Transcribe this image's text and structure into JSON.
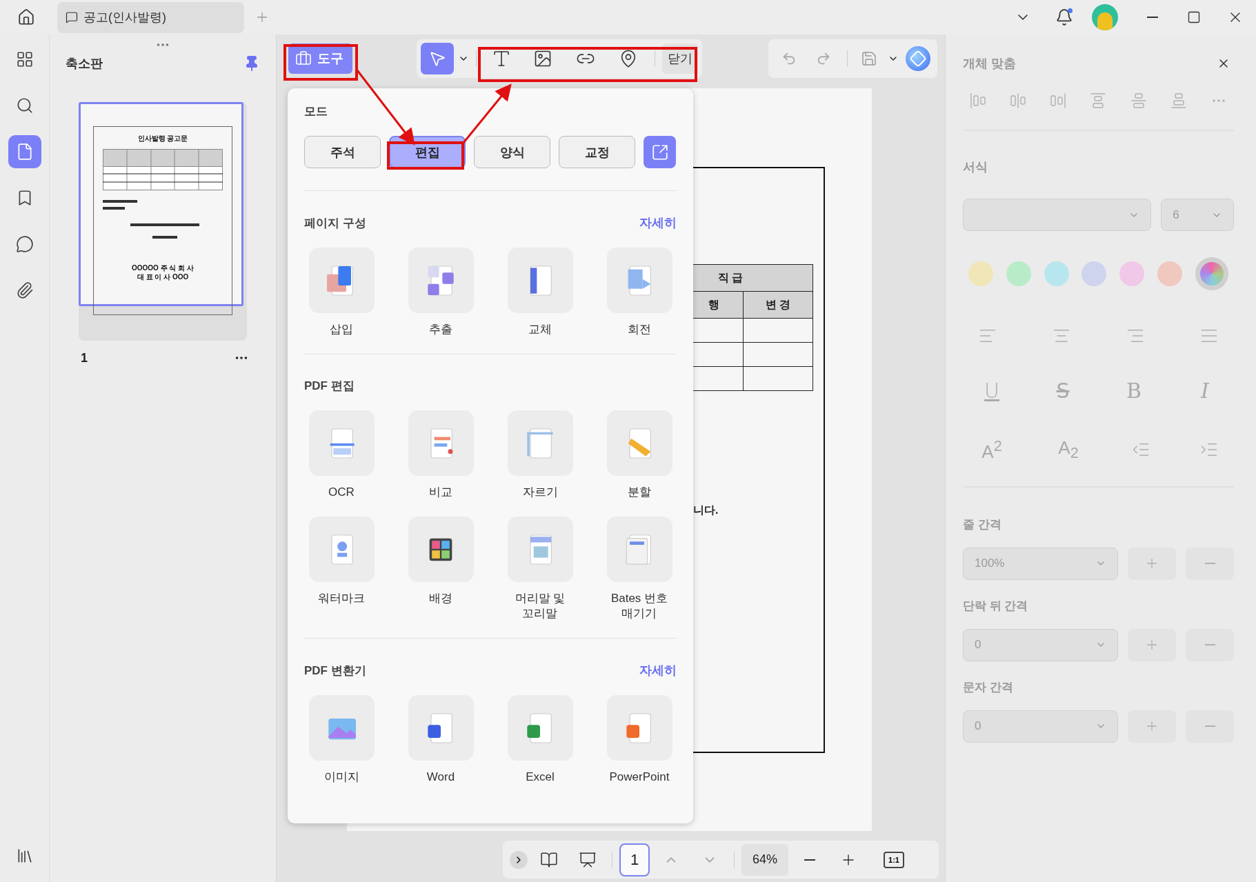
{
  "title_bar": {
    "tabs": [
      {
        "label": "공고(인사발령)",
        "selected": true
      }
    ]
  },
  "left_rail": {
    "items": [
      {
        "selected": false
      },
      {
        "selected": false
      },
      {
        "selected": true
      },
      {
        "selected": false
      },
      {
        "selected": false
      },
      {
        "selected": false
      }
    ]
  },
  "thumbnail_panel": {
    "title": "축소판",
    "pages": [
      {
        "number": "1",
        "selected": true,
        "title": "인사발령 공고문",
        "footer_lines": [
          "OOOOO 주 식 회 사",
          "대 표 이 사 OOO"
        ]
      }
    ]
  },
  "toolbar": {
    "tools_button": "도구",
    "close_button": "닫기"
  },
  "tools_popup": {
    "mode_label": "모드",
    "modes": [
      {
        "label": "주석",
        "selected": false
      },
      {
        "label": "편집",
        "selected": true
      },
      {
        "label": "양식",
        "selected": false
      },
      {
        "label": "교정",
        "selected": false
      }
    ],
    "sections": [
      {
        "title": "페이지 구성",
        "more": "자세히",
        "items": [
          "삽입",
          "추출",
          "교체",
          "회전"
        ]
      },
      {
        "title": "PDF 편집",
        "items": [
          "OCR",
          "비교",
          "자르기",
          "분할",
          "워터마크",
          "배경",
          "머리말 및\n꼬리말",
          "Bates 번호\n매기기"
        ]
      },
      {
        "title": "PDF 변환기",
        "more": "자세히",
        "items": [
          "이미지",
          "Word",
          "Excel",
          "PowerPoint"
        ]
      }
    ]
  },
  "document": {
    "table_header": "직 급",
    "subheaders": [
      "행",
      "변 경"
    ],
    "text": "니다."
  },
  "format_panel": {
    "title": "개체 맞춤",
    "disabled": true,
    "format_label": "서식",
    "font_size": "6",
    "swatches": [
      {
        "kind": "swatch",
        "color": "#f0e6b8"
      },
      {
        "kind": "swatch",
        "color": "#b8ecc8"
      },
      {
        "kind": "swatch",
        "color": "#b8e6ee"
      },
      {
        "kind": "swatch",
        "color": "#cfd4ee"
      },
      {
        "kind": "swatch",
        "color": "#f0c8e8"
      },
      {
        "kind": "swatch",
        "color": "#f0c8c0"
      },
      {
        "kind": "picker"
      }
    ],
    "styles": [
      {
        "label": "U",
        "kind": "underline"
      },
      {
        "label": "S",
        "kind": "strike"
      },
      {
        "label": "B",
        "kind": "bold"
      },
      {
        "label": "I",
        "kind": "italic"
      }
    ],
    "scripts": [
      "A$^{2}$",
      "A$_{2}$"
    ],
    "spacing": [
      {
        "label": "줄 간격",
        "value": "100%"
      },
      {
        "label": "단락 뒤 간격",
        "value": "0"
      },
      {
        "label": "문자 간격",
        "value": "0"
      }
    ]
  },
  "bottom_bar": {
    "page": "1",
    "zoom": "64%",
    "actual_size": "1:1"
  }
}
